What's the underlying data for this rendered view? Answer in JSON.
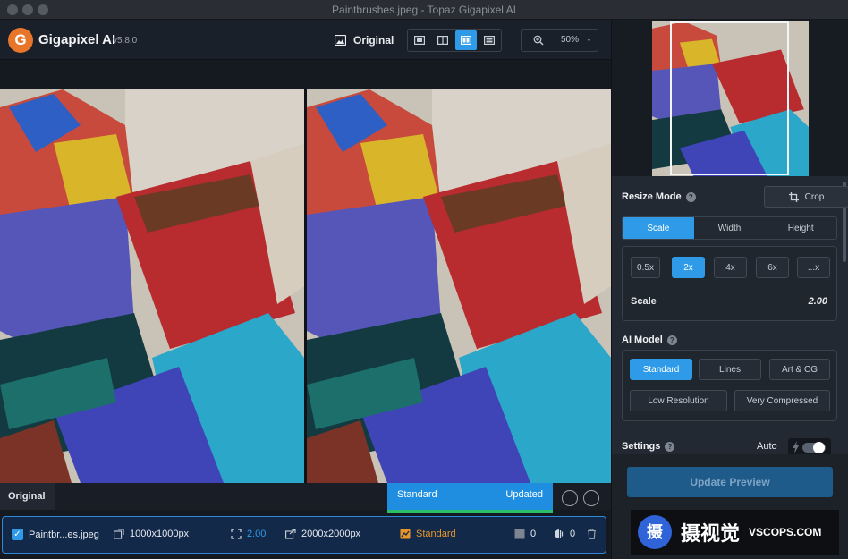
{
  "window": {
    "title": "Paintbrushes.jpeg - Topaz Gigapixel AI"
  },
  "app": {
    "logo_letter": "G",
    "name": "Gigapixel AI",
    "version": "v5.8.0"
  },
  "toolbar": {
    "original_label": "Original",
    "views": [
      "single",
      "split",
      "side-by-side",
      "compare"
    ],
    "active_view": "side-by-side",
    "zoom": "50%"
  },
  "preview": {
    "left_label": "Original",
    "status_model": "Standard",
    "status_state": "Updated"
  },
  "file_row": {
    "name": "Paintbr...es.jpeg",
    "input_size": "1000x1000px",
    "scale": "2.00",
    "output_size": "2000x2000px",
    "model": "Standard",
    "noise": "0",
    "blur": "0"
  },
  "panel": {
    "resize_mode": {
      "title": "Resize Mode",
      "crop_label": "Crop",
      "modes": [
        "Scale",
        "Width",
        "Height"
      ],
      "active_mode": "Scale",
      "scale_options": [
        "0.5x",
        "2x",
        "4x",
        "6x",
        "...x"
      ],
      "active_scale": "2x",
      "scale_label": "Scale",
      "scale_value": "2.00"
    },
    "ai_model": {
      "title": "AI Model",
      "row1": [
        "Standard",
        "Lines",
        "Art & CG"
      ],
      "row2": [
        "Low Resolution",
        "Very Compressed"
      ],
      "active": "Standard"
    },
    "settings": {
      "title": "Settings",
      "auto_label": "Auto",
      "auto_on": true
    },
    "update_label": "Update Preview"
  },
  "watermark": {
    "logo_char": "摄",
    "text": "摄视觉",
    "url": "VSCOPS.COM"
  },
  "colors": {
    "accent": "#2f9be8",
    "success": "#2cbf6a",
    "brand_orange": "#e8762a"
  }
}
